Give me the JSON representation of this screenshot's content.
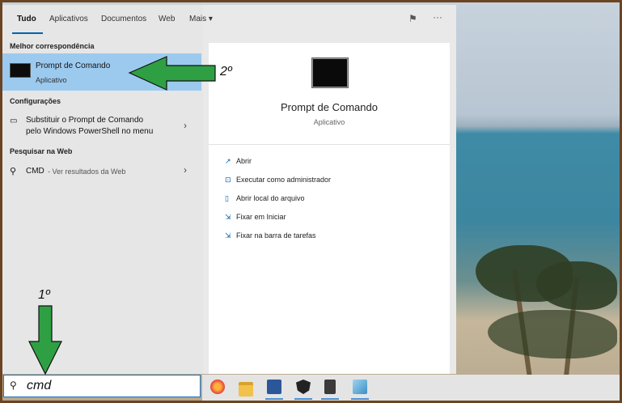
{
  "tabs": [
    "Tudo",
    "Aplicativos",
    "Documentos",
    "Web",
    "Mais ▾"
  ],
  "sections": {
    "best_match": "Melhor correspondência",
    "settings": "Configurações",
    "web": "Pesquisar na Web"
  },
  "best_match_item": {
    "title": "Prompt de Comando",
    "subtitle": "Aplicativo"
  },
  "settings_item": {
    "line1": "Substituir o Prompt de Comando",
    "line2": "pelo Windows PowerShell no menu"
  },
  "web_item": {
    "query": "CMD",
    "hint": " - Ver resultados da Web"
  },
  "detail": {
    "title": "Prompt de Comando",
    "subtitle": "Aplicativo",
    "actions": [
      "Abrir",
      "Executar como administrador",
      "Abrir local do arquivo",
      "Fixar em Iniciar",
      "Fixar na barra de tarefas"
    ]
  },
  "search": {
    "value": "cmd"
  },
  "annotations": {
    "step1": "1º",
    "step2": "2º"
  },
  "icons": {
    "search": "search-icon",
    "feedback": "feedback-icon",
    "more": "more-options-icon"
  },
  "colors": {
    "selected": "#9ccaef",
    "accent": "#0063b1",
    "arrow": "#2ea043"
  }
}
